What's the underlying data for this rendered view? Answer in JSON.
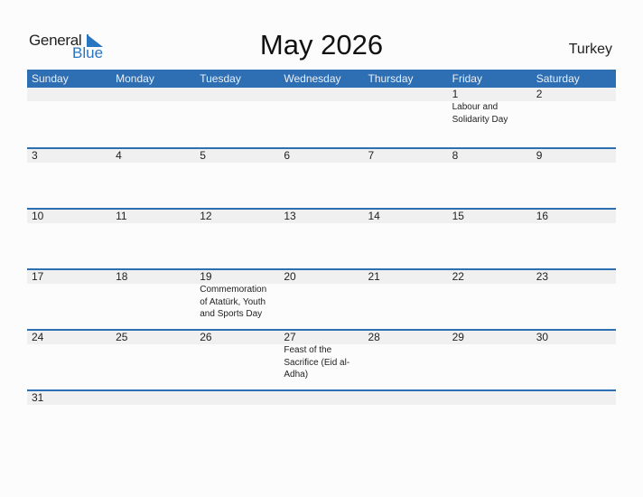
{
  "logo": {
    "general": "General",
    "blue": "Blue"
  },
  "title": "May 2026",
  "country": "Turkey",
  "colors": {
    "header_bg": "#2e6fb3",
    "logo_blue": "#2a75c0",
    "day_band": "#f0f0f0"
  },
  "weekdays": [
    "Sunday",
    "Monday",
    "Tuesday",
    "Wednesday",
    "Thursday",
    "Friday",
    "Saturday"
  ],
  "weeks": [
    [
      {
        "day": "",
        "holiday": ""
      },
      {
        "day": "",
        "holiday": ""
      },
      {
        "day": "",
        "holiday": ""
      },
      {
        "day": "",
        "holiday": ""
      },
      {
        "day": "",
        "holiday": ""
      },
      {
        "day": "1",
        "holiday": "Labour and Solidarity Day"
      },
      {
        "day": "2",
        "holiday": ""
      }
    ],
    [
      {
        "day": "3",
        "holiday": ""
      },
      {
        "day": "4",
        "holiday": ""
      },
      {
        "day": "5",
        "holiday": ""
      },
      {
        "day": "6",
        "holiday": ""
      },
      {
        "day": "7",
        "holiday": ""
      },
      {
        "day": "8",
        "holiday": ""
      },
      {
        "day": "9",
        "holiday": ""
      }
    ],
    [
      {
        "day": "10",
        "holiday": ""
      },
      {
        "day": "11",
        "holiday": ""
      },
      {
        "day": "12",
        "holiday": ""
      },
      {
        "day": "13",
        "holiday": ""
      },
      {
        "day": "14",
        "holiday": ""
      },
      {
        "day": "15",
        "holiday": ""
      },
      {
        "day": "16",
        "holiday": ""
      }
    ],
    [
      {
        "day": "17",
        "holiday": ""
      },
      {
        "day": "18",
        "holiday": ""
      },
      {
        "day": "19",
        "holiday": "Commemoration of Atatürk, Youth and Sports Day"
      },
      {
        "day": "20",
        "holiday": ""
      },
      {
        "day": "21",
        "holiday": ""
      },
      {
        "day": "22",
        "holiday": ""
      },
      {
        "day": "23",
        "holiday": ""
      }
    ],
    [
      {
        "day": "24",
        "holiday": ""
      },
      {
        "day": "25",
        "holiday": ""
      },
      {
        "day": "26",
        "holiday": ""
      },
      {
        "day": "27",
        "holiday": "Feast of the Sacrifice (Eid al-Adha)"
      },
      {
        "day": "28",
        "holiday": ""
      },
      {
        "day": "29",
        "holiday": ""
      },
      {
        "day": "30",
        "holiday": ""
      }
    ],
    [
      {
        "day": "31",
        "holiday": ""
      },
      {
        "day": "",
        "holiday": ""
      },
      {
        "day": "",
        "holiday": ""
      },
      {
        "day": "",
        "holiday": ""
      },
      {
        "day": "",
        "holiday": ""
      },
      {
        "day": "",
        "holiday": ""
      },
      {
        "day": "",
        "holiday": ""
      }
    ]
  ]
}
